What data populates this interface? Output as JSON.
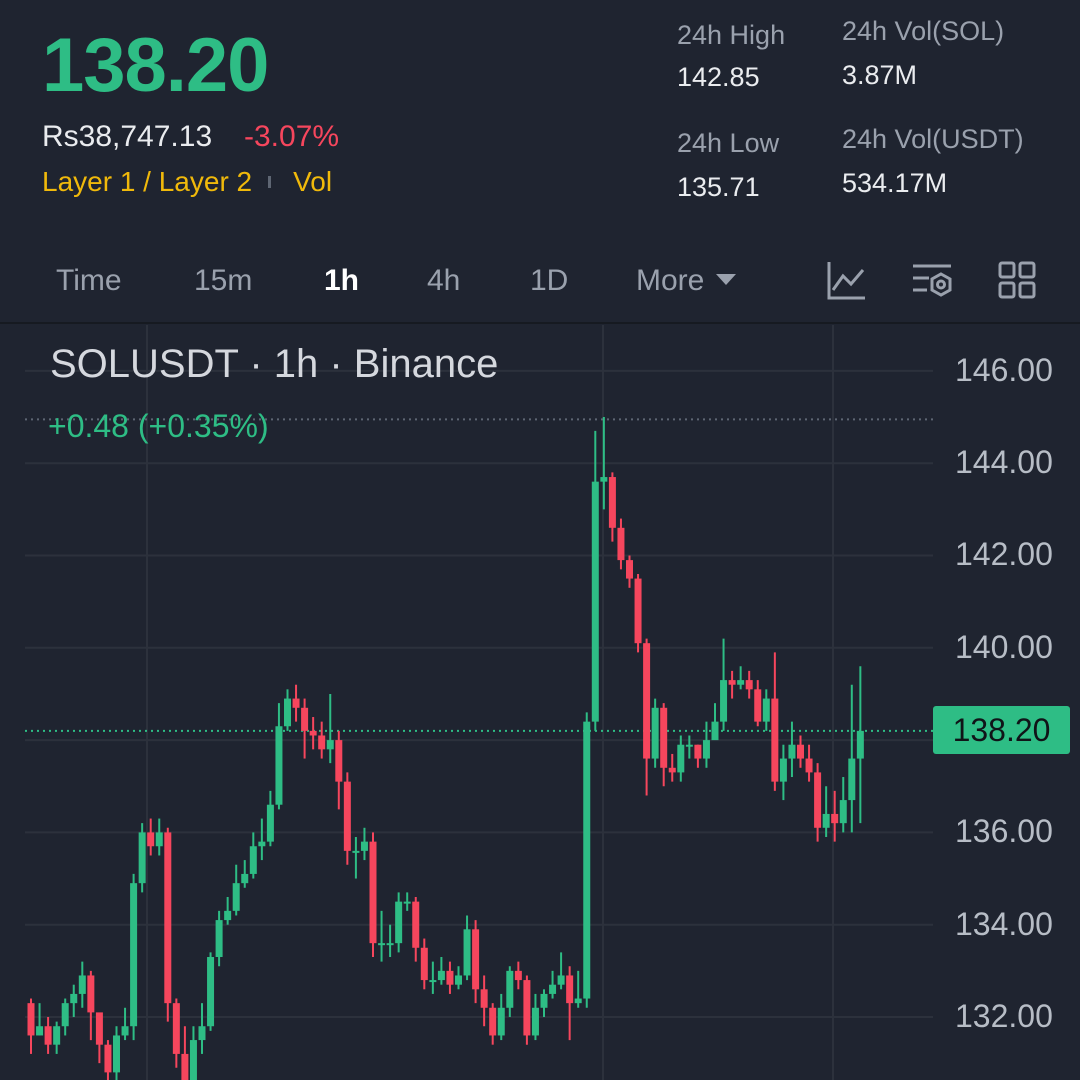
{
  "header": {
    "last_price": "138.20",
    "fiat_price": "Rs38,747.13",
    "change_percent": "-3.07%",
    "tag_category": "Layer 1 / Layer 2",
    "tag_vol": "Vol"
  },
  "stats": {
    "high_label": "24h High",
    "high_value": "142.85",
    "low_label": "24h Low",
    "low_value": "135.71",
    "vol_base_label": "24h Vol(SOL)",
    "vol_base_value": "3.87M",
    "vol_quote_label": "24h Vol(USDT)",
    "vol_quote_value": "534.17M"
  },
  "timeframes": [
    "Time",
    "15m",
    "1h",
    "4h",
    "1D",
    "More"
  ],
  "active_timeframe": "1h",
  "tools": [
    "indicator-chart-icon",
    "chart-settings-icon",
    "layout-grid-icon"
  ],
  "colors": {
    "up": "#2ebd85",
    "down": "#f6465d",
    "accent": "#f0b90b",
    "background": "#1f2430"
  },
  "chart": {
    "title": "SOLUSDT · 1h · Binance",
    "change_text": "+0.48 (+0.35%)",
    "current_price_label": "138.20"
  },
  "chart_data": {
    "type": "candlestick",
    "symbol": "SOLUSDT",
    "interval": "1h",
    "y_ticks": [
      "146.00",
      "144.00",
      "142.00",
      "140.00",
      "138.00",
      "136.00",
      "134.00",
      "132.00"
    ],
    "ylim": [
      130.7,
      147.7
    ],
    "current_price": 138.2,
    "reference_high": 144.95,
    "candles": [
      [
        132.3,
        131.6,
        132.4,
        131.2
      ],
      [
        131.6,
        131.8,
        132.3,
        131.6
      ],
      [
        131.8,
        131.4,
        132.0,
        131.2
      ],
      [
        131.4,
        131.8,
        131.9,
        131.2
      ],
      [
        131.8,
        132.3,
        132.4,
        131.6
      ],
      [
        132.3,
        132.5,
        132.7,
        132.0
      ],
      [
        132.5,
        132.9,
        133.2,
        132.2
      ],
      [
        132.9,
        132.1,
        133.0,
        131.5
      ],
      [
        132.1,
        131.4,
        131.6,
        131.0
      ],
      [
        131.4,
        130.8,
        131.5,
        130.6
      ],
      [
        130.8,
        131.6,
        131.8,
        130.6
      ],
      [
        131.6,
        131.8,
        132.2,
        131.5
      ],
      [
        131.8,
        134.9,
        135.1,
        131.5
      ],
      [
        134.9,
        136.0,
        136.2,
        134.7
      ],
      [
        136.0,
        135.7,
        136.3,
        135.5
      ],
      [
        135.7,
        136.0,
        136.3,
        135.5
      ],
      [
        136.0,
        132.3,
        136.1,
        131.9
      ],
      [
        132.3,
        131.2,
        132.4,
        130.9
      ],
      [
        131.2,
        130.5,
        131.8,
        130.3
      ],
      [
        130.5,
        131.5,
        131.8,
        130.4
      ],
      [
        131.5,
        131.8,
        132.3,
        131.2
      ],
      [
        131.8,
        133.3,
        133.4,
        131.7
      ],
      [
        133.3,
        134.1,
        134.3,
        133.1
      ],
      [
        134.1,
        134.3,
        134.6,
        134.0
      ],
      [
        134.3,
        134.9,
        135.3,
        134.2
      ],
      [
        134.9,
        135.1,
        135.4,
        134.8
      ],
      [
        135.1,
        135.7,
        136.0,
        135.0
      ],
      [
        135.7,
        135.8,
        136.3,
        135.4
      ],
      [
        135.8,
        136.6,
        136.9,
        135.7
      ],
      [
        136.6,
        138.3,
        138.8,
        136.5
      ],
      [
        138.3,
        138.9,
        139.1,
        138.2
      ],
      [
        138.9,
        138.7,
        139.2,
        138.4
      ],
      [
        138.7,
        138.2,
        138.9,
        137.6
      ],
      [
        138.2,
        138.1,
        138.5,
        137.8
      ],
      [
        138.1,
        137.8,
        138.4,
        137.6
      ],
      [
        137.8,
        138.0,
        139.0,
        137.5
      ],
      [
        138.0,
        137.1,
        138.2,
        136.5
      ],
      [
        137.1,
        135.6,
        137.3,
        135.3
      ],
      [
        135.6,
        135.6,
        135.9,
        135.0
      ],
      [
        135.6,
        135.8,
        136.1,
        135.4
      ],
      [
        135.8,
        133.6,
        136.0,
        133.3
      ],
      [
        133.6,
        133.6,
        134.3,
        133.2
      ],
      [
        133.6,
        133.6,
        134.0,
        133.3
      ],
      [
        133.6,
        134.5,
        134.7,
        133.4
      ],
      [
        134.5,
        134.5,
        134.7,
        134.3
      ],
      [
        134.5,
        133.5,
        134.6,
        133.2
      ],
      [
        133.5,
        132.8,
        133.7,
        132.6
      ],
      [
        132.8,
        132.8,
        133.2,
        132.5
      ],
      [
        132.8,
        133.0,
        133.3,
        132.7
      ],
      [
        133.0,
        132.7,
        133.2,
        132.5
      ],
      [
        132.7,
        132.9,
        133.1,
        132.6
      ],
      [
        132.9,
        133.9,
        134.2,
        132.8
      ],
      [
        133.9,
        132.6,
        134.1,
        132.3
      ],
      [
        132.6,
        132.2,
        132.9,
        131.8
      ],
      [
        132.2,
        131.6,
        132.3,
        131.4
      ],
      [
        131.6,
        132.2,
        132.5,
        131.5
      ],
      [
        132.2,
        133.0,
        133.1,
        132.0
      ],
      [
        133.0,
        132.8,
        133.2,
        132.6
      ],
      [
        132.8,
        131.6,
        132.9,
        131.4
      ],
      [
        131.6,
        132.2,
        132.5,
        131.5
      ],
      [
        132.2,
        132.5,
        132.6,
        132.0
      ],
      [
        132.5,
        132.7,
        133.0,
        132.4
      ],
      [
        132.7,
        132.9,
        133.4,
        132.6
      ],
      [
        132.9,
        132.3,
        133.1,
        131.5
      ],
      [
        132.3,
        132.4,
        133.0,
        132.2
      ],
      [
        132.4,
        138.4,
        138.6,
        132.2
      ],
      [
        138.4,
        143.6,
        144.7,
        138.2
      ],
      [
        143.6,
        143.7,
        145.0,
        143.0
      ],
      [
        143.7,
        142.6,
        143.8,
        142.3
      ],
      [
        142.6,
        141.9,
        142.8,
        141.7
      ],
      [
        141.9,
        141.5,
        142.0,
        141.3
      ],
      [
        141.5,
        140.1,
        141.6,
        139.9
      ],
      [
        140.1,
        137.6,
        140.2,
        136.8
      ],
      [
        137.6,
        138.7,
        138.9,
        137.4
      ],
      [
        138.7,
        137.4,
        138.8,
        137.0
      ],
      [
        137.4,
        137.3,
        137.7,
        137.1
      ],
      [
        137.3,
        137.9,
        138.1,
        137.1
      ],
      [
        137.9,
        137.9,
        138.1,
        137.6
      ],
      [
        137.9,
        137.6,
        137.9,
        137.4
      ],
      [
        137.6,
        138.0,
        138.4,
        137.4
      ],
      [
        138.0,
        138.4,
        138.8,
        138.1
      ],
      [
        138.4,
        139.3,
        140.2,
        138.2
      ],
      [
        139.3,
        139.2,
        139.5,
        138.9
      ],
      [
        139.2,
        139.3,
        139.6,
        139.1
      ],
      [
        139.3,
        139.1,
        139.5,
        138.9
      ],
      [
        139.1,
        138.4,
        139.3,
        138.3
      ],
      [
        138.4,
        138.9,
        139.1,
        138.2
      ],
      [
        138.9,
        137.1,
        139.9,
        136.9
      ],
      [
        137.1,
        137.6,
        137.9,
        136.7
      ],
      [
        137.6,
        137.9,
        138.4,
        137.2
      ],
      [
        137.9,
        137.6,
        138.1,
        137.4
      ],
      [
        137.6,
        137.3,
        137.9,
        137.1
      ],
      [
        137.3,
        136.1,
        137.5,
        135.8
      ],
      [
        136.1,
        136.4,
        137.0,
        135.9
      ],
      [
        136.4,
        136.2,
        136.9,
        135.8
      ],
      [
        136.2,
        136.7,
        137.2,
        136.0
      ],
      [
        136.7,
        137.6,
        139.2,
        136.0
      ],
      [
        137.6,
        138.2,
        139.6,
        136.2
      ]
    ]
  }
}
